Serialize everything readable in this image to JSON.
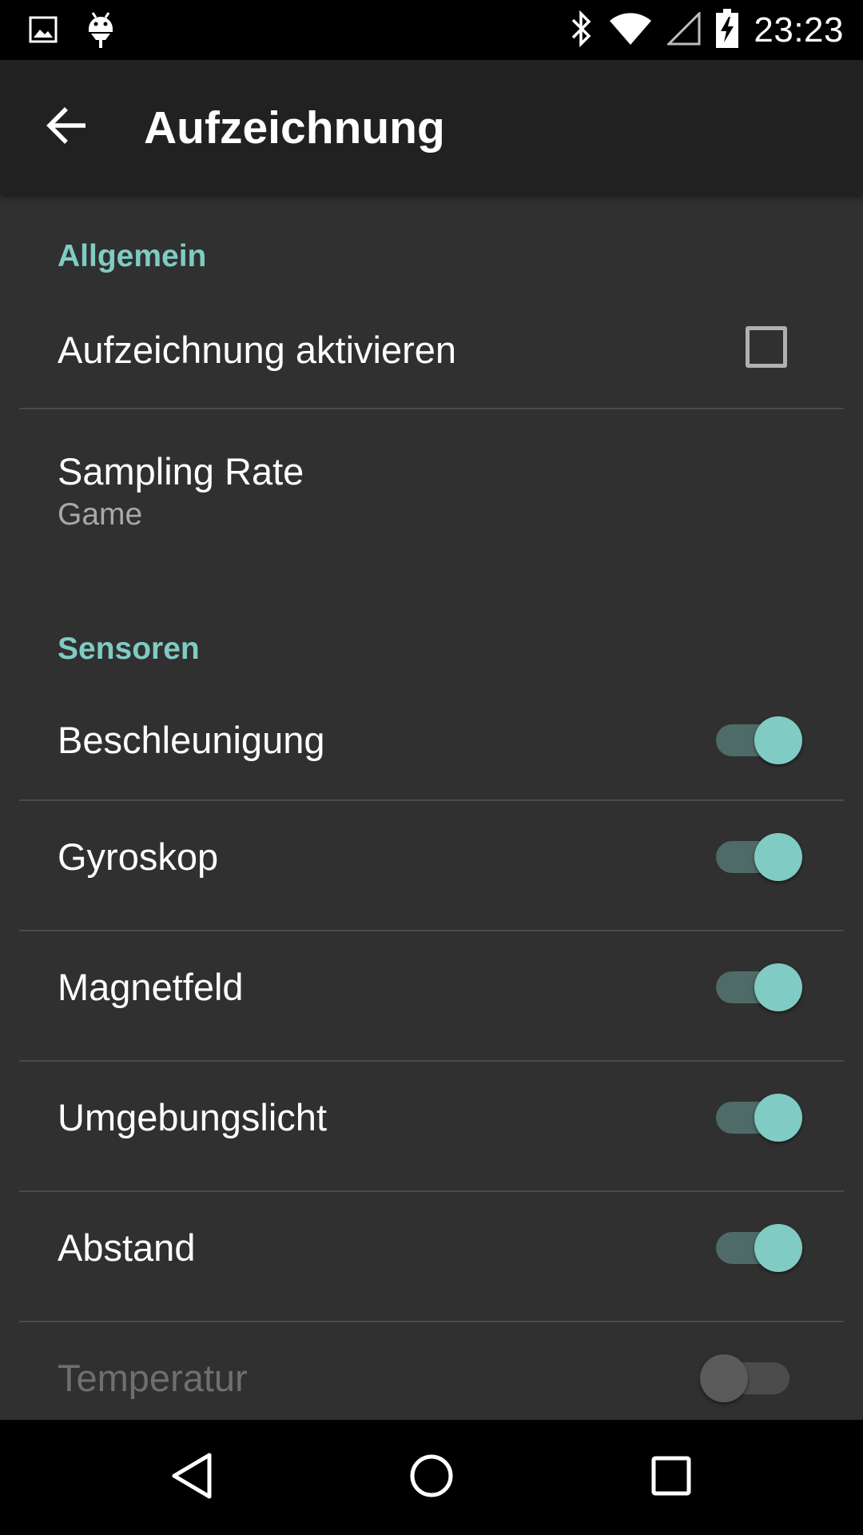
{
  "status_bar": {
    "time": "23:23",
    "left_icons": [
      "image-icon",
      "android-debug-icon"
    ],
    "right_icons": [
      "bluetooth-icon",
      "wifi-icon",
      "signal-icon",
      "battery-charging-icon"
    ]
  },
  "app_bar": {
    "back_icon": "arrow-back-icon",
    "title": "Aufzeichnung"
  },
  "sections": {
    "general": {
      "header": "Allgemein"
    },
    "sensors": {
      "header": "Sensoren"
    }
  },
  "preferences": {
    "enable_recording": {
      "title": "Aufzeichnung aktivieren",
      "checked": false
    },
    "sampling_rate": {
      "title": "Sampling Rate",
      "summary": "Game"
    },
    "acceleration": {
      "title": "Beschleunigung",
      "enabled": true
    },
    "gyroscope": {
      "title": "Gyroskop",
      "enabled": true
    },
    "magnetic_field": {
      "title": "Magnetfeld",
      "enabled": true
    },
    "ambient_light": {
      "title": "Umgebungslicht",
      "enabled": true
    },
    "distance": {
      "title": "Abstand",
      "enabled": true
    },
    "temperature": {
      "title": "Temperatur",
      "enabled": false,
      "disabled": true
    }
  },
  "nav_bar": {
    "icons": [
      "nav-back-icon",
      "nav-home-icon",
      "nav-recents-icon"
    ]
  },
  "colors": {
    "accent": "#80cbc4",
    "background": "#303030",
    "app_bar": "#212121"
  }
}
